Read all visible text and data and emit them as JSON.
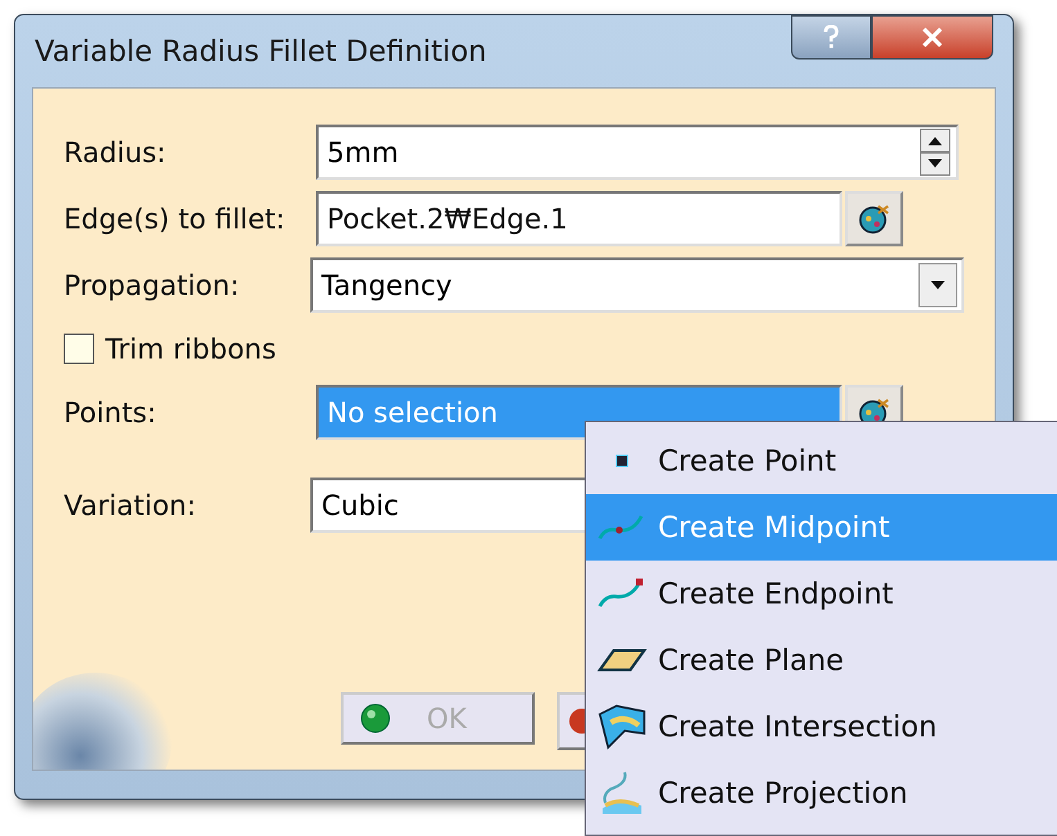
{
  "window": {
    "title": "Variable Radius Fillet Definition"
  },
  "fields": [
    {
      "kind": "spin",
      "label": "Radius:",
      "value": "5mm"
    },
    {
      "kind": "pick",
      "label": "Edge(s) to fillet:",
      "value": "Pocket.2₩Edge.1",
      "highlighted": false
    },
    {
      "kind": "combo",
      "label": "Propagation:",
      "value": "Tangency"
    },
    {
      "kind": "check",
      "label": "Trim ribbons",
      "checked": false
    },
    {
      "kind": "pick",
      "label": "Points:",
      "value": "No selection",
      "highlighted": true
    },
    {
      "kind": "combo",
      "label": "Variation:",
      "value": "Cubic"
    }
  ],
  "buttons": [
    {
      "label": "OK",
      "disabled": true
    }
  ],
  "context_menu": [
    {
      "label": "Create Point",
      "kind": "point",
      "selected": false
    },
    {
      "label": "Create Midpoint",
      "kind": "midpoint",
      "selected": true
    },
    {
      "label": "Create Endpoint",
      "kind": "endpoint",
      "selected": false
    },
    {
      "label": "Create Plane",
      "kind": "plane",
      "selected": false
    },
    {
      "label": "Create Intersection",
      "kind": "intersection",
      "selected": false
    },
    {
      "label": "Create Projection",
      "kind": "projection",
      "selected": false
    }
  ]
}
